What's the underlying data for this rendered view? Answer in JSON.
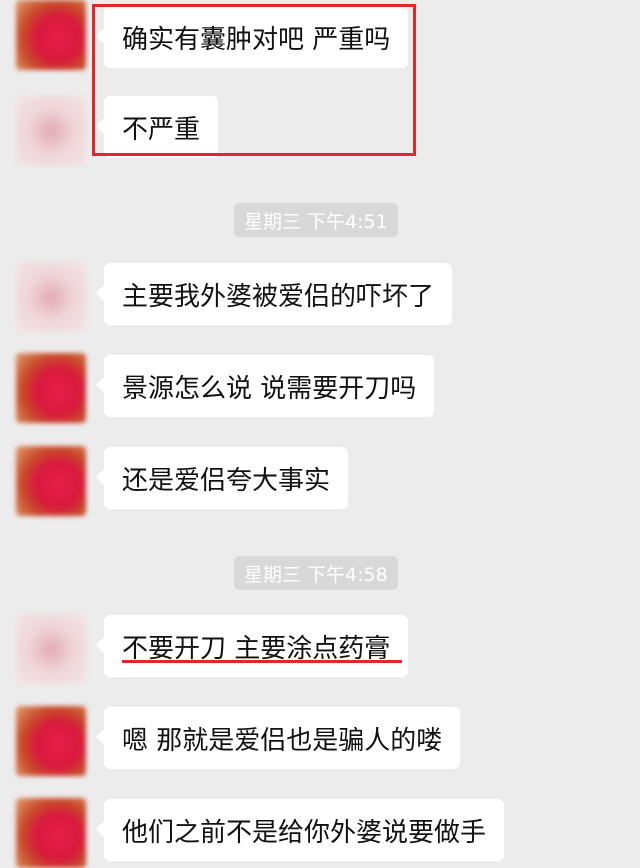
{
  "messages": [
    {
      "text": "确实有囊肿对吧 严重吗",
      "sender": "red"
    },
    {
      "text": "不严重",
      "sender": "pink"
    },
    {
      "text": "主要我外婆被爱侣的吓坏了",
      "sender": "pink"
    },
    {
      "text": "景源怎么说 说需要开刀吗",
      "sender": "red"
    },
    {
      "text": "还是爱侣夸大事实",
      "sender": "red"
    },
    {
      "text": "不要开刀 主要涂点药膏",
      "sender": "pink"
    },
    {
      "text": "嗯 那就是爱侣也是骗人的喽",
      "sender": "red"
    },
    {
      "text": "他们之前不是给你外婆说要做手",
      "sender": "red"
    }
  ],
  "timestamps": [
    "星期三 下午4:51",
    "星期三 下午4:58"
  ],
  "colors": {
    "highlight": "#e0282c",
    "bubble": "#ffffff",
    "background": "#ececec"
  }
}
